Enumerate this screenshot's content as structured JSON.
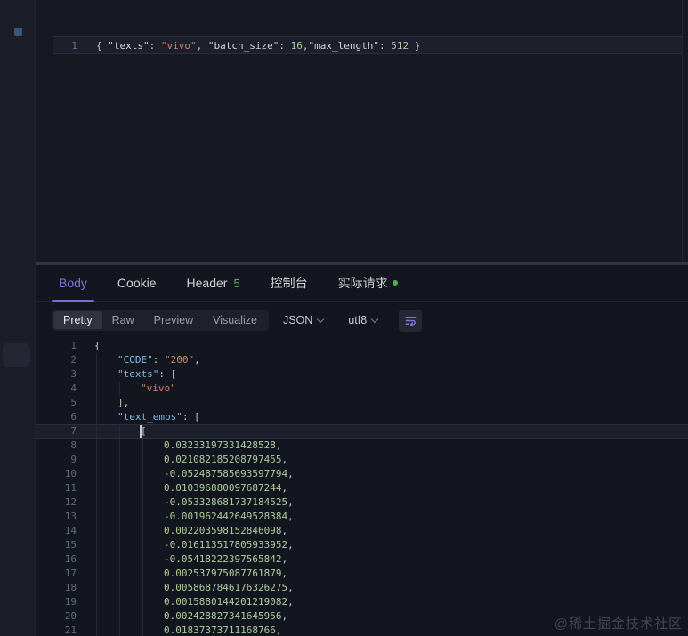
{
  "colors": {
    "accent_purple": "#8276e3",
    "badge_green": "#57b75e",
    "status_dot_green": "#4db44a",
    "key_blue": "#7cb9e8",
    "string_orange": "#cf8163",
    "number_green": "#aecb9c"
  },
  "request": {
    "line_number": "1",
    "code_tokens": [
      {
        "t": "{ ",
        "c": "punct"
      },
      {
        "t": "\"texts\"",
        "c": "rkey"
      },
      {
        "t": ": ",
        "c": "punct"
      },
      {
        "t": "\"vivo\"",
        "c": "string"
      },
      {
        "t": ", ",
        "c": "punct"
      },
      {
        "t": "\"batch_size\"",
        "c": "rkey"
      },
      {
        "t": ": ",
        "c": "punct"
      },
      {
        "t": "16",
        "c": "number"
      },
      {
        "t": ",",
        "c": "punct"
      },
      {
        "t": "\"max_length\"",
        "c": "rkey"
      },
      {
        "t": ": ",
        "c": "punct"
      },
      {
        "t": "512",
        "c": "number"
      },
      {
        "t": " }",
        "c": "punct"
      }
    ]
  },
  "response": {
    "tabs": [
      {
        "id": "body",
        "label": "Body",
        "active": true
      },
      {
        "id": "cookie",
        "label": "Cookie"
      },
      {
        "id": "header",
        "label": "Header",
        "badge": "5"
      },
      {
        "id": "console",
        "label": "控制台"
      },
      {
        "id": "actual-request",
        "label": "实际请求",
        "dot": true
      }
    ],
    "toolbar": {
      "view_modes": [
        "Pretty",
        "Raw",
        "Preview",
        "Visualize"
      ],
      "active_mode": "Pretty",
      "format_select": "JSON",
      "encoding_select": "utf8",
      "wrap_icon": "wrap-text-icon"
    },
    "body_lines": [
      {
        "n": "1",
        "indent": 0,
        "guides": 0,
        "tokens": [
          {
            "t": "{",
            "c": "punct"
          }
        ]
      },
      {
        "n": "2",
        "indent": 1,
        "guides": 1,
        "tokens": [
          {
            "t": "\"CODE\"",
            "c": "key"
          },
          {
            "t": ": ",
            "c": "punct"
          },
          {
            "t": "\"200\"",
            "c": "string"
          },
          {
            "t": ",",
            "c": "punct"
          }
        ]
      },
      {
        "n": "3",
        "indent": 1,
        "guides": 1,
        "tokens": [
          {
            "t": "\"texts\"",
            "c": "key"
          },
          {
            "t": ": ",
            "c": "punct"
          },
          {
            "t": "[",
            "c": "punct"
          }
        ]
      },
      {
        "n": "4",
        "indent": 2,
        "guides": 2,
        "tokens": [
          {
            "t": "\"vivo\"",
            "c": "string"
          }
        ]
      },
      {
        "n": "5",
        "indent": 1,
        "guides": 1,
        "tokens": [
          {
            "t": "],",
            "c": "punct"
          }
        ]
      },
      {
        "n": "6",
        "indent": 1,
        "guides": 1,
        "tokens": [
          {
            "t": "\"text_embs\"",
            "c": "key"
          },
          {
            "t": ": ",
            "c": "punct"
          },
          {
            "t": "[",
            "c": "punct"
          }
        ]
      },
      {
        "n": "7",
        "indent": 2,
        "guides": 2,
        "current": true,
        "cursor": true,
        "tokens": [
          {
            "t": "[",
            "c": "punct"
          }
        ]
      },
      {
        "n": "8",
        "indent": 3,
        "guides": 3,
        "tokens": [
          {
            "t": "0.03233197331428528",
            "c": "number"
          },
          {
            "t": ",",
            "c": "punct"
          }
        ]
      },
      {
        "n": "9",
        "indent": 3,
        "guides": 3,
        "tokens": [
          {
            "t": "0.021082185208797455",
            "c": "number"
          },
          {
            "t": ",",
            "c": "punct"
          }
        ]
      },
      {
        "n": "10",
        "indent": 3,
        "guides": 3,
        "tokens": [
          {
            "t": "-0.052487585693597794",
            "c": "number"
          },
          {
            "t": ",",
            "c": "punct"
          }
        ]
      },
      {
        "n": "11",
        "indent": 3,
        "guides": 3,
        "tokens": [
          {
            "t": "0.010396880097687244",
            "c": "number"
          },
          {
            "t": ",",
            "c": "punct"
          }
        ]
      },
      {
        "n": "12",
        "indent": 3,
        "guides": 3,
        "tokens": [
          {
            "t": "-0.053328681737184525",
            "c": "number"
          },
          {
            "t": ",",
            "c": "punct"
          }
        ]
      },
      {
        "n": "13",
        "indent": 3,
        "guides": 3,
        "tokens": [
          {
            "t": "-0.001962442649528384",
            "c": "number"
          },
          {
            "t": ",",
            "c": "punct"
          }
        ]
      },
      {
        "n": "14",
        "indent": 3,
        "guides": 3,
        "tokens": [
          {
            "t": "0.002203598152846098",
            "c": "number"
          },
          {
            "t": ",",
            "c": "punct"
          }
        ]
      },
      {
        "n": "15",
        "indent": 3,
        "guides": 3,
        "tokens": [
          {
            "t": "-0.016113517805933952",
            "c": "number"
          },
          {
            "t": ",",
            "c": "punct"
          }
        ]
      },
      {
        "n": "16",
        "indent": 3,
        "guides": 3,
        "tokens": [
          {
            "t": "-0.05418222397565842",
            "c": "number"
          },
          {
            "t": ",",
            "c": "punct"
          }
        ]
      },
      {
        "n": "17",
        "indent": 3,
        "guides": 3,
        "tokens": [
          {
            "t": "0.002537975087761879",
            "c": "number"
          },
          {
            "t": ",",
            "c": "punct"
          }
        ]
      },
      {
        "n": "18",
        "indent": 3,
        "guides": 3,
        "tokens": [
          {
            "t": "0.0058687846176326275",
            "c": "number"
          },
          {
            "t": ",",
            "c": "punct"
          }
        ]
      },
      {
        "n": "19",
        "indent": 3,
        "guides": 3,
        "tokens": [
          {
            "t": "0.0015880144201219082",
            "c": "number"
          },
          {
            "t": ",",
            "c": "punct"
          }
        ]
      },
      {
        "n": "20",
        "indent": 3,
        "guides": 3,
        "tokens": [
          {
            "t": "0.002428827341645956",
            "c": "number"
          },
          {
            "t": ",",
            "c": "punct"
          }
        ]
      },
      {
        "n": "21",
        "indent": 3,
        "guides": 3,
        "tokens": [
          {
            "t": "0.01837373711168766",
            "c": "number"
          },
          {
            "t": ",",
            "c": "punct"
          }
        ]
      }
    ]
  },
  "watermark": "@稀土掘金技术社区"
}
